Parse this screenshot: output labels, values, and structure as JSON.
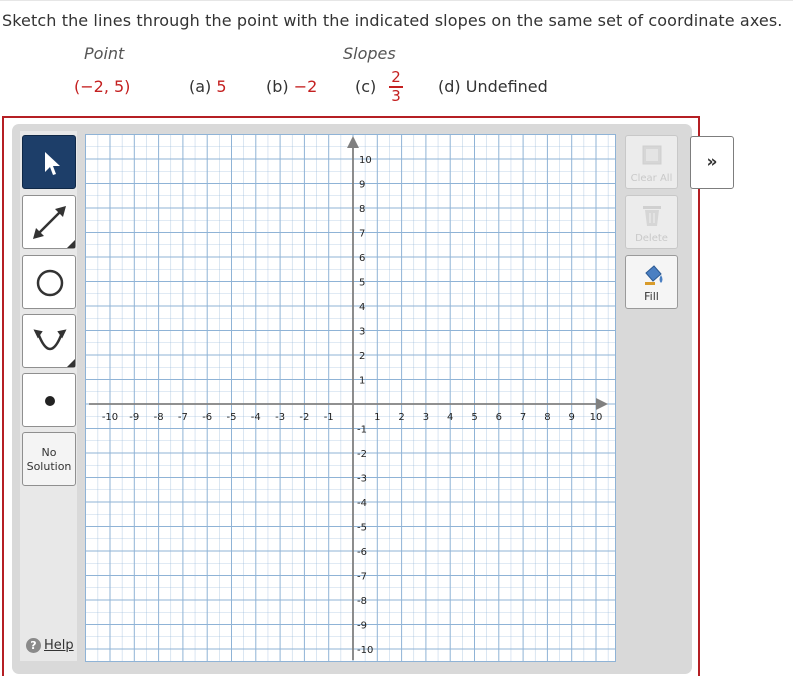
{
  "question": {
    "instruction": "Sketch the lines through the point with the indicated slopes on the same set of coordinate axes.",
    "point_header": "Point",
    "slopes_header": "Slopes",
    "point_value": "(−2, 5)",
    "slope_a_label": "(a)",
    "slope_a_value": "5",
    "slope_b_label": "(b)",
    "slope_b_value": "−2",
    "slope_c_label": "(c)",
    "slope_c_num": "2",
    "slope_c_den": "3",
    "slope_d_label": "(d)",
    "slope_d_value": "Undefined",
    "value_color": "#c42020"
  },
  "toolbar": {
    "tools": [
      {
        "name": "pointer",
        "icon": "arrow-cursor-icon",
        "active": true
      },
      {
        "name": "line",
        "icon": "line-arrow-icon",
        "active": false
      },
      {
        "name": "circle",
        "icon": "circle-icon",
        "active": false
      },
      {
        "name": "parabola",
        "icon": "parabola-icon",
        "active": false
      },
      {
        "name": "point",
        "icon": "dot-icon",
        "active": false
      }
    ],
    "no_solution_line1": "No",
    "no_solution_line2": "Solution",
    "help_label": "Help",
    "help_icon": "question-icon"
  },
  "right_buttons": {
    "clear_all": "Clear All",
    "delete": "Delete",
    "fill": "Fill",
    "expand": "»"
  },
  "graph": {
    "x_ticks": [
      "-10",
      "-9",
      "-8",
      "-7",
      "-6",
      "-5",
      "-4",
      "-3",
      "-2",
      "-1",
      "1",
      "2",
      "3",
      "4",
      "5",
      "6",
      "7",
      "8",
      "9",
      "10"
    ],
    "y_ticks_pos": [
      "10",
      "9",
      "8",
      "7",
      "6",
      "5",
      "4",
      "3",
      "2",
      "1"
    ],
    "y_ticks_neg": [
      "-1",
      "-2",
      "-3",
      "-4",
      "-5",
      "-6",
      "-7",
      "-8",
      "-9",
      "-10"
    ],
    "xmin": -10.5,
    "xmax": 10.5,
    "ymin": -10.5,
    "ymax": 11.0,
    "grid_color": "#8fb3d6",
    "axis_color": "#808080"
  }
}
